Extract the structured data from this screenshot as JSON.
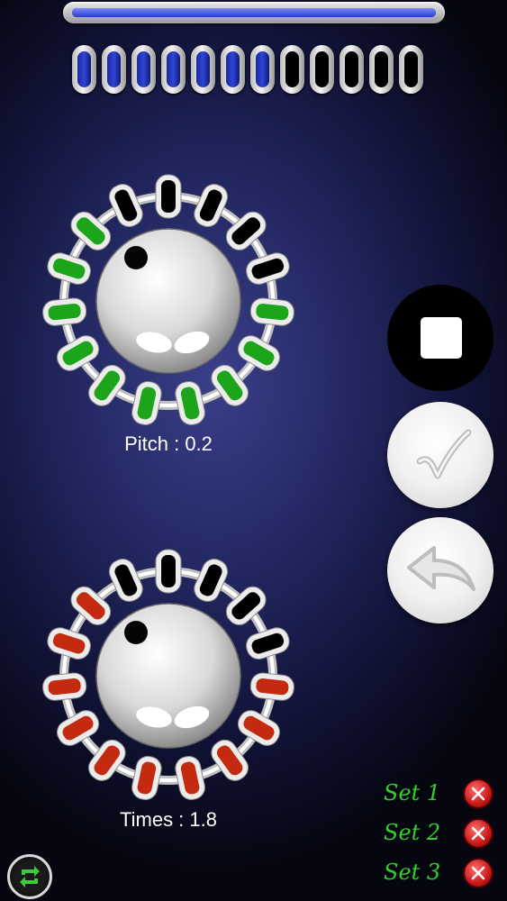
{
  "progress": {
    "value": 1.0,
    "fill_color": "#3347e0"
  },
  "leds": {
    "total": 12,
    "active": [
      true,
      true,
      true,
      true,
      true,
      true,
      true,
      false,
      false,
      false,
      false,
      false
    ],
    "on_color": "#2f45d8"
  },
  "pitch_knob": {
    "label": "Pitch : 0.2",
    "segment_states": [
      0,
      0,
      0,
      0,
      1,
      1,
      1,
      1,
      1,
      1,
      1,
      1,
      1,
      1,
      0
    ],
    "on_color": "#1ca51a",
    "icon": "knob"
  },
  "times_knob": {
    "label": "Times : 1.8",
    "segment_states": [
      0,
      0,
      0,
      0,
      1,
      1,
      1,
      1,
      1,
      1,
      1,
      1,
      1,
      1,
      0
    ],
    "on_color": "#c42a10",
    "icon": "knob"
  },
  "controls": {
    "stop_icon": "stop-icon",
    "confirm_icon": "checkmark-icon",
    "back_icon": "back-arrow-icon"
  },
  "sets": [
    {
      "label": "Set 1",
      "delete_icon": "close-circle-icon"
    },
    {
      "label": "Set 2",
      "delete_icon": "close-circle-icon"
    },
    {
      "label": "Set 3",
      "delete_icon": "close-circle-icon"
    }
  ],
  "rotate_icon": "rotate-icon",
  "colors": {
    "set_label": "#2fd12a",
    "delete_red": "#c81818"
  }
}
